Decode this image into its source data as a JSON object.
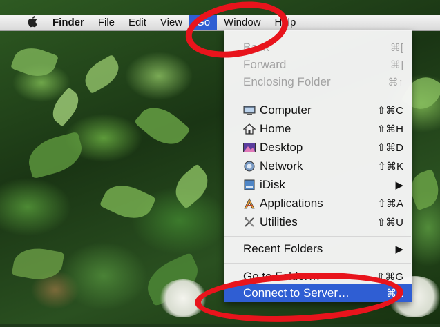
{
  "menubar": {
    "apple_icon": "apple-icon",
    "items": [
      "Finder",
      "File",
      "Edit",
      "View",
      "Go",
      "Window",
      "Help"
    ]
  },
  "go_menu": {
    "history": [
      {
        "label": "Back",
        "shortcut": "⌘["
      },
      {
        "label": "Forward",
        "shortcut": "⌘]"
      },
      {
        "label": "Enclosing Folder",
        "shortcut": "⌘↑"
      }
    ],
    "places": [
      {
        "label": "Computer",
        "shortcut": "⇧⌘C",
        "icon": "computer-icon"
      },
      {
        "label": "Home",
        "shortcut": "⇧⌘H",
        "icon": "home-icon"
      },
      {
        "label": "Desktop",
        "shortcut": "⇧⌘D",
        "icon": "desktop-icon"
      },
      {
        "label": "Network",
        "shortcut": "⇧⌘K",
        "icon": "network-icon"
      },
      {
        "label": "iDisk",
        "shortcut": "▶",
        "icon": "idisk-icon"
      },
      {
        "label": "Applications",
        "shortcut": "⇧⌘A",
        "icon": "applications-icon"
      },
      {
        "label": "Utilities",
        "shortcut": "⇧⌘U",
        "icon": "utilities-icon"
      }
    ],
    "recent": {
      "label": "Recent Folders",
      "shortcut": "▶"
    },
    "goto": {
      "label": "Go to Folder…",
      "shortcut": "⇧⌘G"
    },
    "connect": {
      "label": "Connect to Server…",
      "shortcut": "⌘K"
    }
  },
  "colors": {
    "highlight": "#2f5ed3",
    "annotation": "#e8141c"
  }
}
